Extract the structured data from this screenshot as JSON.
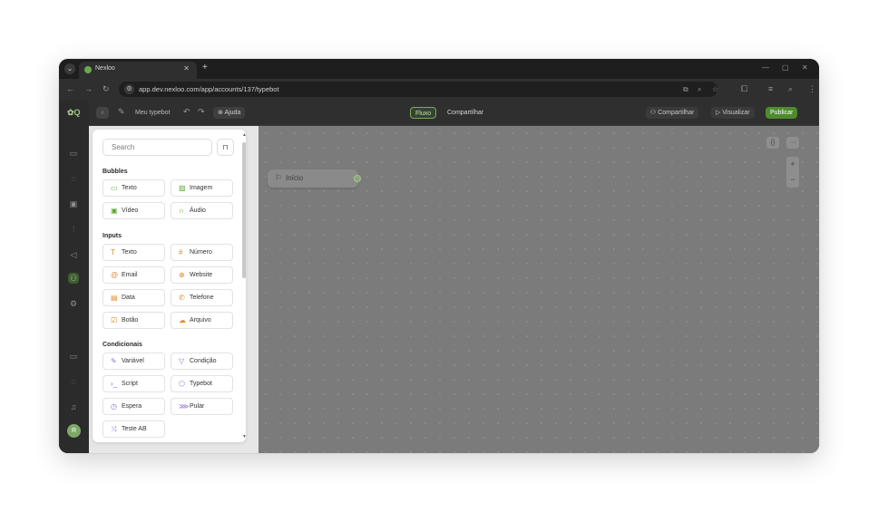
{
  "browser": {
    "tab_title": "Nexloo",
    "url": "app.dev.nexloo.com/app/accounts/137/typebot"
  },
  "app": {
    "logo": "✿Q"
  },
  "toolbar": {
    "bot_name": "Meu typebot",
    "help_label": "Ajuda",
    "tab_fluxo": "Fluxo",
    "tab_compartilhar": "Compartilhar",
    "share_label": "Compartilhar",
    "visualize_label": "Visualizar",
    "publish_label": "Publicar"
  },
  "panel": {
    "search_placeholder": "Search",
    "sections": {
      "bubbles": "Bubbles",
      "inputs": "Inputs",
      "conditionals": "Condicionais"
    },
    "bubbles": [
      "Texto",
      "Imagem",
      "Vídeo",
      "Áudio"
    ],
    "inputs": [
      "Texto",
      "Número",
      "Email",
      "Website",
      "Data",
      "Telefone",
      "Botão",
      "Arquivo"
    ],
    "conditionals": [
      "Variável",
      "Condição",
      "Script",
      "Typebot",
      "Espera",
      "Pular",
      "Teste AB"
    ]
  },
  "canvas": {
    "start_node_label": "Início",
    "code_btn": "{}",
    "more_btn": "···",
    "zoom_in": "+",
    "zoom_out": "−"
  },
  "user": {
    "avatar_initial": "R"
  },
  "colors": {
    "publish": "#4e8b2f",
    "accent_green": "#5aa636"
  }
}
